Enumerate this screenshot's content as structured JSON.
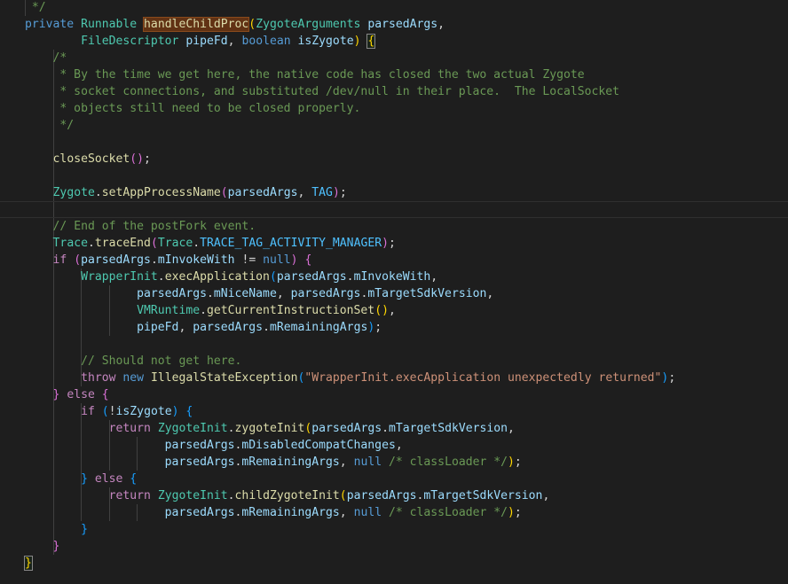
{
  "editor": {
    "theme_colors": {
      "background": "#1e1e1e",
      "keyword": "#569cd6",
      "type": "#4ec9b0",
      "function": "#dcdcaa",
      "variable": "#9cdcfe",
      "constant": "#4fc1ff",
      "string": "#ce9178",
      "comment": "#6a9955",
      "bracket_level1": "#ffd700",
      "bracket_level2": "#da70d6",
      "bracket_level3": "#179fff"
    },
    "lines": [
      [
        {
          "t": " */",
          "c": "cm"
        }
      ],
      [
        {
          "t": "private",
          "c": "kw"
        },
        {
          "t": " ",
          "c": "p"
        },
        {
          "t": "Runnable",
          "c": "ty"
        },
        {
          "t": " ",
          "c": "p"
        },
        {
          "t": "handleChildProc",
          "c": "fn hl-word"
        },
        {
          "t": "(",
          "c": "br1"
        },
        {
          "t": "ZygoteArguments",
          "c": "ty"
        },
        {
          "t": " ",
          "c": "p"
        },
        {
          "t": "parsedArgs",
          "c": "var"
        },
        {
          "t": ",",
          "c": "p"
        }
      ],
      [
        {
          "t": "        ",
          "c": "p"
        },
        {
          "t": "FileDescriptor",
          "c": "ty"
        },
        {
          "t": " ",
          "c": "p"
        },
        {
          "t": "pipeFd",
          "c": "var"
        },
        {
          "t": ", ",
          "c": "p"
        },
        {
          "t": "boolean",
          "c": "kw"
        },
        {
          "t": " ",
          "c": "p"
        },
        {
          "t": "isZygote",
          "c": "var"
        },
        {
          "t": ")",
          "c": "br1"
        },
        {
          "t": " ",
          "c": "p"
        },
        {
          "t": "{",
          "c": "br1 match-brace"
        }
      ],
      [
        {
          "t": "    /*",
          "c": "cm"
        }
      ],
      [
        {
          "t": "     * By the time we get here, the native code has closed the two actual Zygote",
          "c": "cm"
        }
      ],
      [
        {
          "t": "     * socket connections, and substituted /dev/null in their place.  The LocalSocket",
          "c": "cm"
        }
      ],
      [
        {
          "t": "     * objects still need to be closed properly.",
          "c": "cm"
        }
      ],
      [
        {
          "t": "     */",
          "c": "cm"
        }
      ],
      [],
      [
        {
          "t": "    ",
          "c": "p"
        },
        {
          "t": "closeSocket",
          "c": "fn"
        },
        {
          "t": "()",
          "c": "br2"
        },
        {
          "t": ";",
          "c": "p"
        }
      ],
      [],
      [
        {
          "t": "    ",
          "c": "p"
        },
        {
          "t": "Zygote",
          "c": "ty"
        },
        {
          "t": ".",
          "c": "p"
        },
        {
          "t": "setAppProcessName",
          "c": "fn"
        },
        {
          "t": "(",
          "c": "br2"
        },
        {
          "t": "parsedArgs",
          "c": "var"
        },
        {
          "t": ", ",
          "c": "p"
        },
        {
          "t": "TAG",
          "c": "const"
        },
        {
          "t": ")",
          "c": "br2"
        },
        {
          "t": ";",
          "c": "p"
        }
      ],
      [],
      [
        {
          "t": "    ",
          "c": "p"
        },
        {
          "t": "// End of the postFork event.",
          "c": "cm"
        }
      ],
      [
        {
          "t": "    ",
          "c": "p"
        },
        {
          "t": "Trace",
          "c": "ty"
        },
        {
          "t": ".",
          "c": "p"
        },
        {
          "t": "traceEnd",
          "c": "fn"
        },
        {
          "t": "(",
          "c": "br2"
        },
        {
          "t": "Trace",
          "c": "ty"
        },
        {
          "t": ".",
          "c": "p"
        },
        {
          "t": "TRACE_TAG_ACTIVITY_MANAGER",
          "c": "const"
        },
        {
          "t": ")",
          "c": "br2"
        },
        {
          "t": ";",
          "c": "p"
        }
      ],
      [
        {
          "t": "    ",
          "c": "p"
        },
        {
          "t": "if",
          "c": "kw2"
        },
        {
          "t": " ",
          "c": "p"
        },
        {
          "t": "(",
          "c": "br2"
        },
        {
          "t": "parsedArgs",
          "c": "var"
        },
        {
          "t": ".",
          "c": "p"
        },
        {
          "t": "mInvokeWith",
          "c": "var"
        },
        {
          "t": " != ",
          "c": "p"
        },
        {
          "t": "null",
          "c": "kw"
        },
        {
          "t": ")",
          "c": "br2"
        },
        {
          "t": " ",
          "c": "p"
        },
        {
          "t": "{",
          "c": "br2"
        }
      ],
      [
        {
          "t": "        ",
          "c": "p"
        },
        {
          "t": "WrapperInit",
          "c": "ty"
        },
        {
          "t": ".",
          "c": "p"
        },
        {
          "t": "execApplication",
          "c": "fn"
        },
        {
          "t": "(",
          "c": "br3"
        },
        {
          "t": "parsedArgs",
          "c": "var"
        },
        {
          "t": ".",
          "c": "p"
        },
        {
          "t": "mInvokeWith",
          "c": "var"
        },
        {
          "t": ",",
          "c": "p"
        }
      ],
      [
        {
          "t": "                ",
          "c": "p"
        },
        {
          "t": "parsedArgs",
          "c": "var"
        },
        {
          "t": ".",
          "c": "p"
        },
        {
          "t": "mNiceName",
          "c": "var"
        },
        {
          "t": ", ",
          "c": "p"
        },
        {
          "t": "parsedArgs",
          "c": "var"
        },
        {
          "t": ".",
          "c": "p"
        },
        {
          "t": "mTargetSdkVersion",
          "c": "var"
        },
        {
          "t": ",",
          "c": "p"
        }
      ],
      [
        {
          "t": "                ",
          "c": "p"
        },
        {
          "t": "VMRuntime",
          "c": "ty"
        },
        {
          "t": ".",
          "c": "p"
        },
        {
          "t": "getCurrentInstructionSet",
          "c": "fn"
        },
        {
          "t": "()",
          "c": "br1"
        },
        {
          "t": ",",
          "c": "p"
        }
      ],
      [
        {
          "t": "                ",
          "c": "p"
        },
        {
          "t": "pipeFd",
          "c": "var"
        },
        {
          "t": ", ",
          "c": "p"
        },
        {
          "t": "parsedArgs",
          "c": "var"
        },
        {
          "t": ".",
          "c": "p"
        },
        {
          "t": "mRemainingArgs",
          "c": "var"
        },
        {
          "t": ")",
          "c": "br3"
        },
        {
          "t": ";",
          "c": "p"
        }
      ],
      [],
      [
        {
          "t": "        ",
          "c": "p"
        },
        {
          "t": "// Should not get here.",
          "c": "cm"
        }
      ],
      [
        {
          "t": "        ",
          "c": "p"
        },
        {
          "t": "throw",
          "c": "kw2"
        },
        {
          "t": " ",
          "c": "p"
        },
        {
          "t": "new",
          "c": "kw"
        },
        {
          "t": " ",
          "c": "p"
        },
        {
          "t": "IllegalStateException",
          "c": "fn"
        },
        {
          "t": "(",
          "c": "br3"
        },
        {
          "t": "\"WrapperInit.execApplication unexpectedly returned\"",
          "c": "str"
        },
        {
          "t": ")",
          "c": "br3"
        },
        {
          "t": ";",
          "c": "p"
        }
      ],
      [
        {
          "t": "    ",
          "c": "p"
        },
        {
          "t": "}",
          "c": "br2"
        },
        {
          "t": " ",
          "c": "p"
        },
        {
          "t": "else",
          "c": "kw2"
        },
        {
          "t": " ",
          "c": "p"
        },
        {
          "t": "{",
          "c": "br2"
        }
      ],
      [
        {
          "t": "        ",
          "c": "p"
        },
        {
          "t": "if",
          "c": "kw2"
        },
        {
          "t": " ",
          "c": "p"
        },
        {
          "t": "(",
          "c": "br3"
        },
        {
          "t": "!",
          "c": "p"
        },
        {
          "t": "isZygote",
          "c": "var"
        },
        {
          "t": ")",
          "c": "br3"
        },
        {
          "t": " ",
          "c": "p"
        },
        {
          "t": "{",
          "c": "br3"
        }
      ],
      [
        {
          "t": "            ",
          "c": "p"
        },
        {
          "t": "return",
          "c": "kw2"
        },
        {
          "t": " ",
          "c": "p"
        },
        {
          "t": "ZygoteInit",
          "c": "ty"
        },
        {
          "t": ".",
          "c": "p"
        },
        {
          "t": "zygoteInit",
          "c": "fn"
        },
        {
          "t": "(",
          "c": "br1"
        },
        {
          "t": "parsedArgs",
          "c": "var"
        },
        {
          "t": ".",
          "c": "p"
        },
        {
          "t": "mTargetSdkVersion",
          "c": "var"
        },
        {
          "t": ",",
          "c": "p"
        }
      ],
      [
        {
          "t": "                    ",
          "c": "p"
        },
        {
          "t": "parsedArgs",
          "c": "var"
        },
        {
          "t": ".",
          "c": "p"
        },
        {
          "t": "mDisabledCompatChanges",
          "c": "var"
        },
        {
          "t": ",",
          "c": "p"
        }
      ],
      [
        {
          "t": "                    ",
          "c": "p"
        },
        {
          "t": "parsedArgs",
          "c": "var"
        },
        {
          "t": ".",
          "c": "p"
        },
        {
          "t": "mRemainingArgs",
          "c": "var"
        },
        {
          "t": ", ",
          "c": "p"
        },
        {
          "t": "null",
          "c": "kw"
        },
        {
          "t": " ",
          "c": "p"
        },
        {
          "t": "/* classLoader */",
          "c": "cm"
        },
        {
          "t": ")",
          "c": "br1"
        },
        {
          "t": ";",
          "c": "p"
        }
      ],
      [
        {
          "t": "        ",
          "c": "p"
        },
        {
          "t": "}",
          "c": "br3"
        },
        {
          "t": " ",
          "c": "p"
        },
        {
          "t": "else",
          "c": "kw2"
        },
        {
          "t": " ",
          "c": "p"
        },
        {
          "t": "{",
          "c": "br3"
        }
      ],
      [
        {
          "t": "            ",
          "c": "p"
        },
        {
          "t": "return",
          "c": "kw2"
        },
        {
          "t": " ",
          "c": "p"
        },
        {
          "t": "ZygoteInit",
          "c": "ty"
        },
        {
          "t": ".",
          "c": "p"
        },
        {
          "t": "childZygoteInit",
          "c": "fn"
        },
        {
          "t": "(",
          "c": "br1"
        },
        {
          "t": "parsedArgs",
          "c": "var"
        },
        {
          "t": ".",
          "c": "p"
        },
        {
          "t": "mTargetSdkVersion",
          "c": "var"
        },
        {
          "t": ",",
          "c": "p"
        }
      ],
      [
        {
          "t": "                    ",
          "c": "p"
        },
        {
          "t": "parsedArgs",
          "c": "var"
        },
        {
          "t": ".",
          "c": "p"
        },
        {
          "t": "mRemainingArgs",
          "c": "var"
        },
        {
          "t": ", ",
          "c": "p"
        },
        {
          "t": "null",
          "c": "kw"
        },
        {
          "t": " ",
          "c": "p"
        },
        {
          "t": "/* classLoader */",
          "c": "cm"
        },
        {
          "t": ")",
          "c": "br1"
        },
        {
          "t": ";",
          "c": "p"
        }
      ],
      [
        {
          "t": "        ",
          "c": "p"
        },
        {
          "t": "}",
          "c": "br3"
        }
      ],
      [
        {
          "t": "    ",
          "c": "p"
        },
        {
          "t": "}",
          "c": "br2"
        }
      ],
      [
        {
          "t": "}",
          "c": "br1 match-brace"
        }
      ]
    ]
  }
}
